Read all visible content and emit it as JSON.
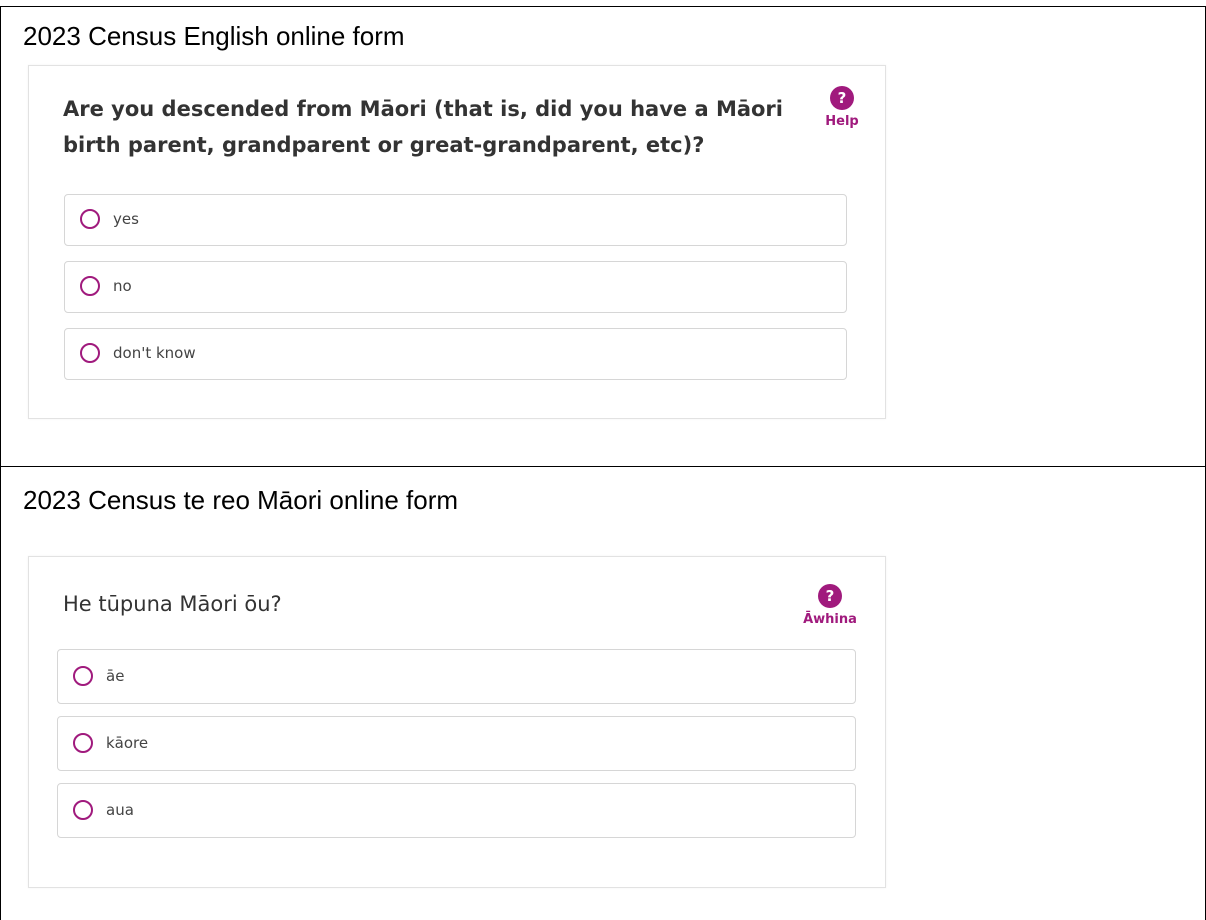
{
  "english": {
    "caption": "2023 Census English online form",
    "question": "Are you descended from Māori (that is, did you have a Māori birth parent, grandparent or great-grandparent, etc)?",
    "help_icon": "?",
    "help_label": "Help",
    "options": [
      {
        "label": "yes"
      },
      {
        "label": "no"
      },
      {
        "label": "don't know"
      }
    ]
  },
  "maori": {
    "caption": "2023 Census te reo Māori online form",
    "question": "He tūpuna Māori ōu?",
    "help_icon": "?",
    "help_label": "Āwhina",
    "options": [
      {
        "label": "āe"
      },
      {
        "label": "kāore"
      },
      {
        "label": "aua"
      }
    ]
  },
  "colors": {
    "accent": "#a01a7d",
    "border": "#d6d6d6"
  }
}
